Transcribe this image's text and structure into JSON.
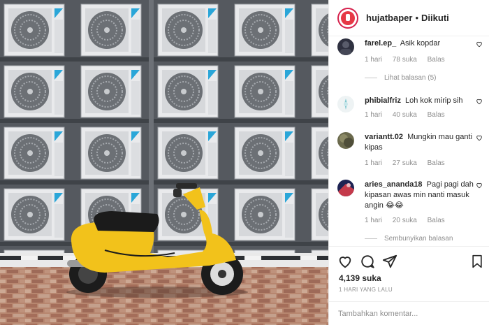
{
  "post": {
    "username": "hujatbaper",
    "separator": "•",
    "follow_status": "Diikuti",
    "likes": "4,139 suka",
    "timestamp": "1 HARI YANG LALU",
    "comment_placeholder": "Tambahkan komentar..."
  },
  "comments": [
    {
      "username": "farel.ep_",
      "text": "Asik kopdar",
      "age": "1 hari",
      "likes": "78 suka",
      "reply_label": "Balas",
      "view_replies": "Lihat balasan (5)"
    },
    {
      "username": "phibialfriz",
      "text": "Loh kok mirip sih",
      "age": "1 hari",
      "likes": "40 suka",
      "reply_label": "Balas"
    },
    {
      "username": "variantt.02",
      "text": "Mungkin mau ganti kipas",
      "age": "1 hari",
      "likes": "27 suka",
      "reply_label": "Balas"
    },
    {
      "username": "aries_ananda18",
      "text": "Pagi pagi dah kipasan awas min nanti masuk angin 😂😂",
      "age": "1 hari",
      "likes": "20 suka",
      "reply_label": "Balas",
      "hide_replies": "Sembunyikan balasan"
    }
  ],
  "icons": [
    "heart-icon",
    "comment-icon",
    "share-icon",
    "bookmark-icon",
    "like-comment-icon"
  ],
  "colors": {
    "scooter": "#f2c21b",
    "avatar_ring": "#d6224d",
    "meta_gray": "#8e8e8e",
    "text_dark": "#262626"
  }
}
